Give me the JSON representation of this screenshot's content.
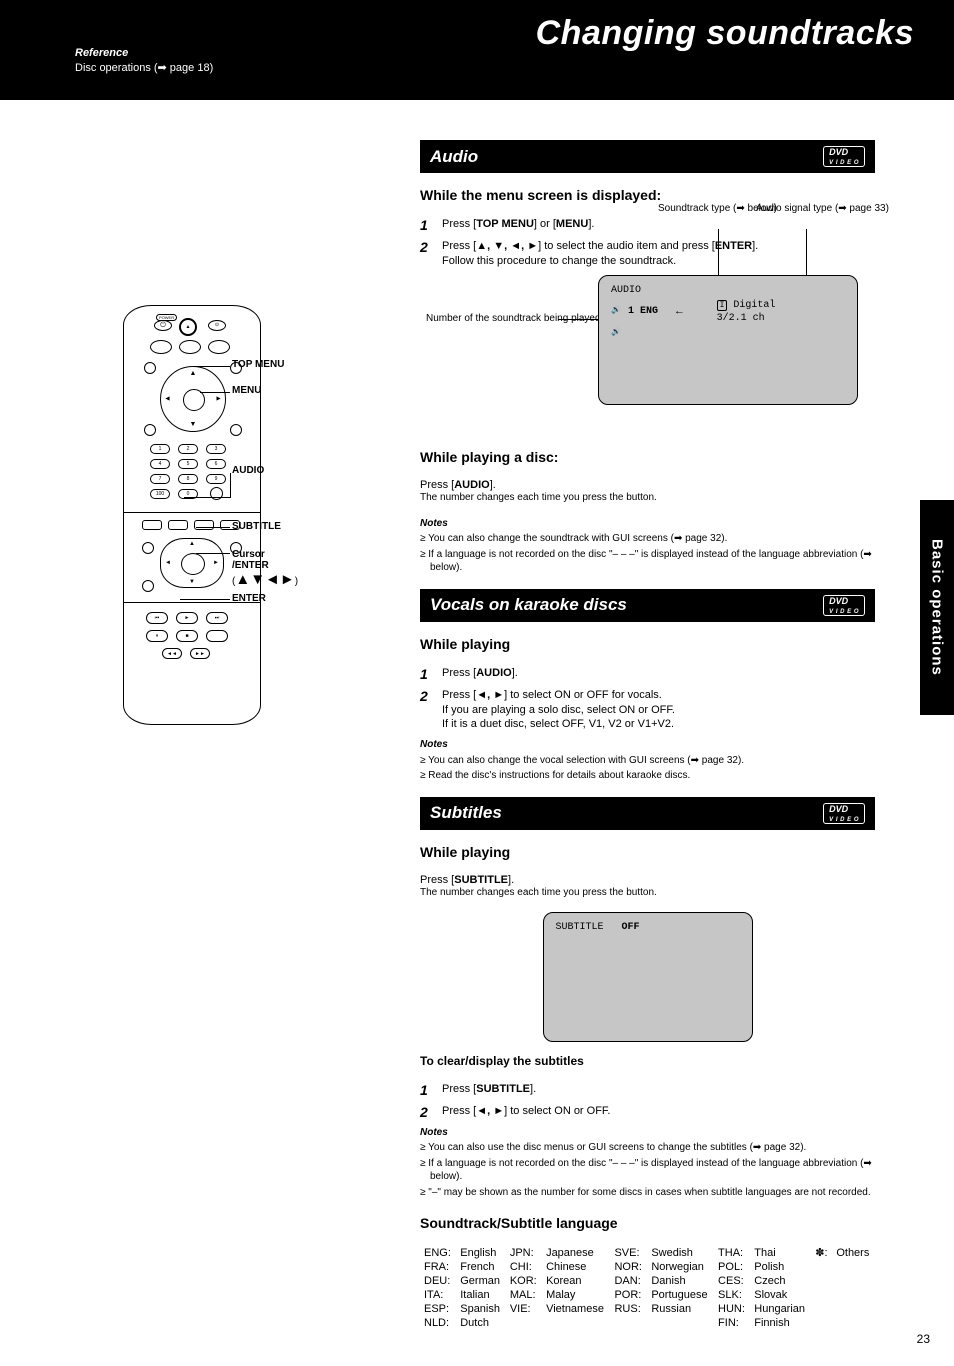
{
  "header": {
    "title": "Changing soundtracks",
    "ref": {
      "label": "Reference",
      "text1": "Disc operations ",
      "text2": "(➡ page 18)"
    }
  },
  "sideTab": "Basic operations",
  "pageNum": "23",
  "sec1": {
    "heading": "Audio",
    "dvdBadge": {
      "line1": "DVD",
      "line2": "V I D E O"
    },
    "lead": "While the menu screen is displayed:",
    "steps": [
      {
        "n": "1",
        "html": "Press [<b>TOP MENU</b>] or [<b>MENU</b>]."
      },
      {
        "n": "2",
        "html": "Press [<b>▲, ▼, ◄, ►</b>] to select the audio item and press [<b>ENTER</b>].<br>Follow this procedure to change the soundtrack."
      }
    ],
    "sub": "While playing a disc:",
    "body": "Press [<b>AUDIO</b>].<br><span style='font-size:10px'>The number changes each time you press the button.</span>",
    "osdLabels": {
      "currentSoundtrack": "Number of the soundtrack being played",
      "soundtrackType": "Soundtrack type (➡ below)",
      "audioSignalType": "Audio signal type (➡ page 33)"
    },
    "osd": {
      "line1": "AUDIO",
      "line2": "1 ENG",
      "line3": "Digital",
      "line4": "3/2.1 ch"
    },
    "notes": {
      "title": "Notes",
      "items": [
        "You can also change the soundtrack with GUI screens (➡ page 32).",
        "If a language is not recorded on the disc \"– – –\" is displayed instead of the language abbreviation (➡ below)."
      ]
    }
  },
  "sec2": {
    "heading": "Vocals on karaoke discs",
    "dvdBadge": {
      "line1": "DVD",
      "line2": "V I D E O"
    },
    "sub": "While playing",
    "steps": [
      {
        "n": "1",
        "html": "Press [<b>AUDIO</b>]."
      },
      {
        "n": "2",
        "html": "Press [<b>◄, ►</b>] to select ON or OFF for vocals.<br>If you are playing a solo disc, select ON or OFF.<br>If it is a duet disc, select OFF, V1, V2 or V1+V2."
      }
    ],
    "notes": {
      "title": "Notes",
      "items": [
        "You can also change the vocal selection with GUI screens (➡ page 32).",
        "Read the disc's instructions for details about karaoke discs."
      ]
    }
  },
  "sec3": {
    "heading": "Subtitles",
    "dvdBadge": {
      "line1": "DVD",
      "line2": "V I D E O"
    },
    "sub": "While playing",
    "body": "Press [<b>SUBTITLE</b>].<br><span style='font-size:10px'>The number changes each time you press the button.</span>",
    "osd": {
      "line1": "SUBTITLE",
      "line2": "OFF"
    },
    "clearHd": "To clear/display the subtitles",
    "clearSteps": [
      {
        "n": "1",
        "html": "Press [<b>SUBTITLE</b>]."
      },
      {
        "n": "2",
        "html": "Press [<b>◄, ►</b>] to select ON or OFF."
      }
    ],
    "notes": {
      "title": "Notes",
      "items": [
        "You can also use the disc menus or GUI screens to change the subtitles (➡ page 32).",
        "If a language is not recorded on the disc \"– – –\" is displayed instead of the language abbreviation (➡ below).",
        "\"–\" may be shown as the number for some discs in cases when subtitle languages are not recorded."
      ]
    }
  },
  "langTable": {
    "heading": "Soundtrack/Subtitle language",
    "rows": [
      [
        "ENG:",
        "English",
        "JPN:",
        "Japanese",
        "SVE:",
        "Swedish",
        "THA:",
        "Thai"
      ],
      [
        "FRA:",
        "French",
        "CHI:",
        "Chinese",
        "NOR:",
        "Norwegian",
        "POL:",
        "Polish"
      ],
      [
        "DEU:",
        "German",
        "KOR:",
        "Korean",
        "DAN:",
        "Danish",
        "CES:",
        "Czech"
      ],
      [
        "ITA:",
        "Italian",
        "MAL:",
        "Malay",
        "POR:",
        "Portuguese",
        "SLK:",
        "Slovak"
      ],
      [
        "ESP:",
        "Spanish",
        "VIE:",
        "Vietnamese",
        "RUS:",
        "Russian",
        "HUN:",
        "Hungarian"
      ],
      [
        "NLD:",
        "Dutch",
        "",
        "",
        "",
        "",
        "FIN:",
        "Finnish"
      ]
    ],
    "lastCol": [
      "✽:",
      "Others"
    ]
  },
  "remote": {
    "audio": "AUDIO",
    "subtitle": "SUBTITLE",
    "cursorEnter": "Cursor\n/ENTER",
    "enter": "ENTER",
    "menu": "MENU",
    "topMenu": "TOP MENU"
  }
}
